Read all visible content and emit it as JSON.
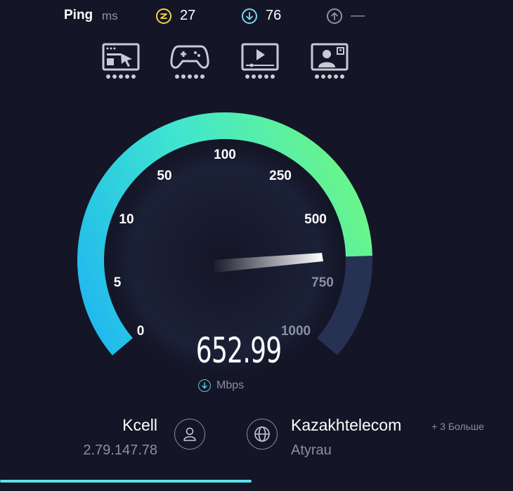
{
  "header": {
    "ping_label": "Ping",
    "ping_unit": "ms",
    "jitter_icon": "jitter-icon",
    "jitter_value": "27",
    "download_icon": "download-arrow-icon",
    "download_value": "76",
    "upload_icon": "upload-arrow-icon",
    "upload_value": "—"
  },
  "activities": [
    {
      "icon": "web-browsing-icon"
    },
    {
      "icon": "gaming-icon"
    },
    {
      "icon": "video-streaming-icon"
    },
    {
      "icon": "video-call-icon"
    }
  ],
  "gauge": {
    "scale_labels": [
      "0",
      "5",
      "10",
      "50",
      "100",
      "250",
      "500",
      "750",
      "1000"
    ],
    "speed_value": "652.99",
    "unit_icon": "download-arrow-icon",
    "unit": "Mbps",
    "gradient_start": "#1fb6f0",
    "gradient_end": "#6af58a",
    "remaining_color": "#273152"
  },
  "connection": {
    "isp_name": "Kcell",
    "isp_ip": "2.79.147.78",
    "user_icon": "user-icon",
    "globe_icon": "globe-icon",
    "server_name": "Kazakhtelecom",
    "server_more": "+ 3 Больше",
    "server_location": "Atyrau"
  },
  "progress": {
    "fraction": 0.49,
    "color": "#5ee0ea"
  }
}
